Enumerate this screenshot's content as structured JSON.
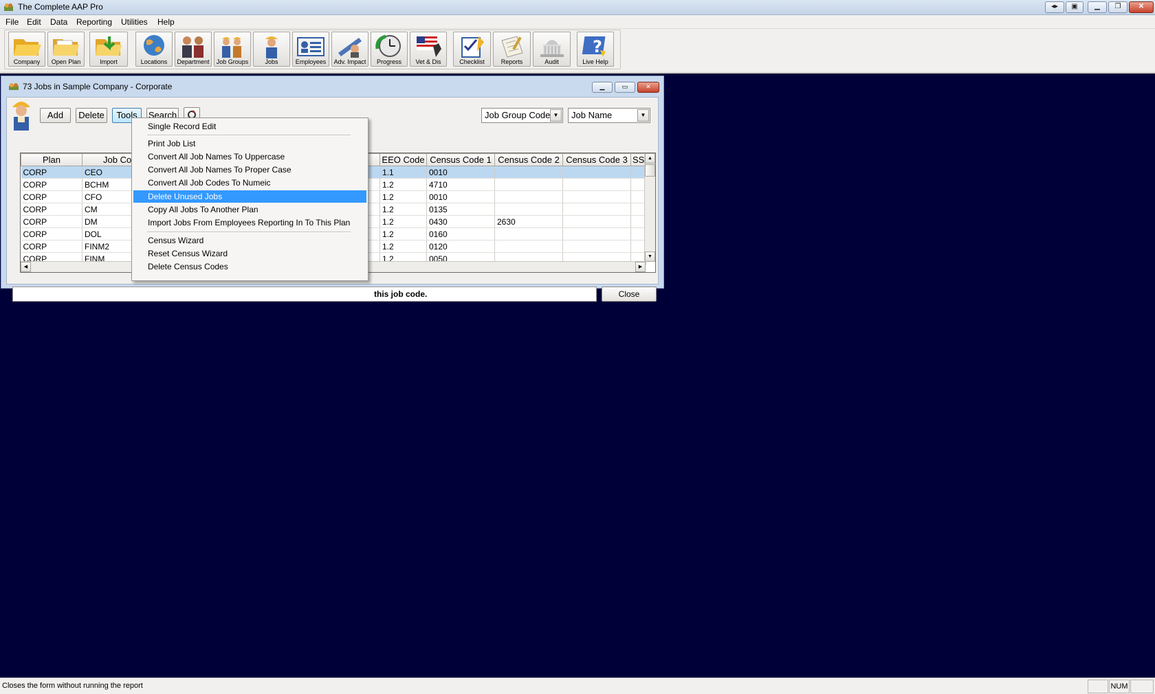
{
  "app": {
    "title": "The Complete AAP Pro",
    "menu": [
      "File",
      "Edit",
      "Data",
      "Reporting",
      "Utilities",
      "Help"
    ]
  },
  "toolbar": {
    "buttons": [
      {
        "label": "Company",
        "icon": "folder-open-icon"
      },
      {
        "label": "Open Plan",
        "icon": "folder-icon"
      },
      {
        "label": "Import",
        "icon": "import-folder-icon"
      },
      {
        "label": "Locations",
        "icon": "globe-icon"
      },
      {
        "label": "Department",
        "icon": "people-group-icon"
      },
      {
        "label": "Job Groups",
        "icon": "workers-icon"
      },
      {
        "label": "Jobs",
        "icon": "worker-icon"
      },
      {
        "label": "Employees",
        "icon": "id-card-icon"
      },
      {
        "label": "Adv. Impact",
        "icon": "scale-icon"
      },
      {
        "label": "Progress",
        "icon": "clock-icon"
      },
      {
        "label": "Vet & Dis",
        "icon": "flag-icon"
      },
      {
        "label": "Checklist",
        "icon": "checklist-icon"
      },
      {
        "label": "Reports",
        "icon": "report-icon"
      },
      {
        "label": "Audit",
        "icon": "capitol-icon"
      },
      {
        "label": "Live Help",
        "icon": "help-icon"
      }
    ]
  },
  "window": {
    "title": "73 Jobs in Sample Company - Corporate",
    "buttons": {
      "add": "Add",
      "delete": "Delete",
      "tools": "Tools",
      "search": "Search",
      "close": "Close"
    },
    "sort1": "Job Group Code",
    "sort2": "Job Name",
    "status_text": "this job code."
  },
  "grid": {
    "columns": [
      "Plan",
      "Job Cod",
      "EEO Code",
      "Census Code 1",
      "Census Code 2",
      "Census Code 3",
      "SS"
    ],
    "rows": [
      [
        "CORP",
        "CEO",
        "1.1",
        "0010",
        "",
        ""
      ],
      [
        "CORP",
        "BCHM",
        "1.2",
        "4710",
        "",
        ""
      ],
      [
        "CORP",
        "CFO",
        "1.2",
        "0010",
        "",
        ""
      ],
      [
        "CORP",
        "CM",
        "1.2",
        "0135",
        "",
        ""
      ],
      [
        "CORP",
        "DM",
        "1.2",
        "0430",
        "2630",
        ""
      ],
      [
        "CORP",
        "DOL",
        "1.2",
        "0160",
        "",
        ""
      ],
      [
        "CORP",
        "FINM2",
        "1.2",
        "0120",
        "",
        ""
      ],
      [
        "CORP",
        "FINM",
        "1.2",
        "0050",
        "",
        ""
      ]
    ],
    "selected_row": 0
  },
  "tools_menu": {
    "items": [
      "Single Record Edit",
      "Print Job List",
      "Convert All Job Names To Uppercase",
      "Convert All Job Names To Proper Case",
      "Convert All Job Codes To Numeic",
      "Delete Unused Jobs",
      "Copy All Jobs To Another Plan",
      "Import Jobs From Employees Reporting In To This Plan",
      "Census Wizard",
      "Reset Census Wizard",
      "Delete Census Codes"
    ],
    "highlighted": "Delete Unused Jobs"
  },
  "statusbar": {
    "message": "Closes the form without running the report",
    "num": "NUM"
  }
}
